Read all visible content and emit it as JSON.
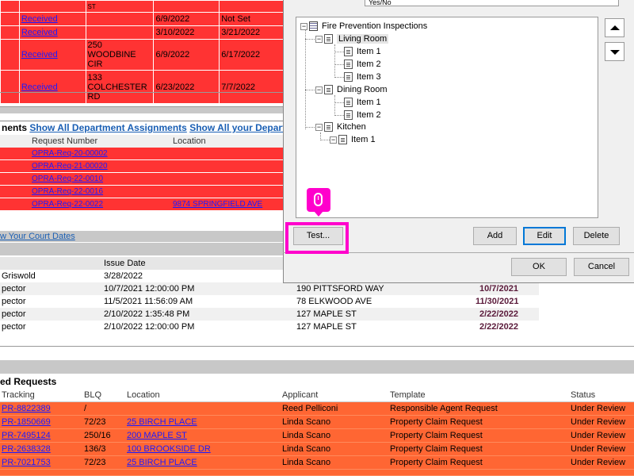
{
  "top_grid": {
    "rows": [
      {
        "status": "Received",
        "address": "ST",
        "date1": "6/9/2022",
        "date2": "Not Set"
      },
      {
        "status": "Received",
        "address": "",
        "date1": "3/10/2022",
        "date2": "3/21/2022"
      },
      {
        "status": "Received",
        "address": "250 WOODBINE CIR",
        "date1": "6/9/2022",
        "date2": "6/17/2022"
      },
      {
        "status": "Received",
        "address": "133 COLCHESTER RD",
        "date1": "6/23/2022",
        "date2": "7/7/2022"
      }
    ]
  },
  "dept_bar": {
    "prefix": "nents",
    "link1": "Show All Department Assignments",
    "link2": "Show All your Departm"
  },
  "opra": {
    "col_request": "Request Number",
    "col_location": "Location",
    "rows": [
      {
        "number": "OPRA-Req-20-00002",
        "location": ""
      },
      {
        "number": "OPRA-Req-21-00020",
        "location": ""
      },
      {
        "number": "OPRA-Req-22-0010",
        "location": ""
      },
      {
        "number": "OPRA-Req-22-0016",
        "location": ""
      },
      {
        "number": "OPRA-Req-22-0022",
        "location": "9874 SPRINGFIELD AVE"
      }
    ]
  },
  "court_link": "w Your Court Dates",
  "inspections": {
    "col_issue": "Issue Date",
    "rows": [
      {
        "name": "Griswold",
        "issue": "3/28/2022",
        "address": "",
        "due": ""
      },
      {
        "name": "pector",
        "issue": "10/7/2021 12:00:00 PM",
        "address": "190 PITTSFORD WAY",
        "due": "10/7/2021"
      },
      {
        "name": "pector",
        "issue": "11/5/2021 11:56:09 AM",
        "address": "78 ELKWOOD AVE",
        "due": "11/30/2021"
      },
      {
        "name": "pector",
        "issue": "2/10/2022 1:35:48 PM",
        "address": "127 MAPLE ST",
        "due": "2/22/2022"
      },
      {
        "name": "pector",
        "issue": "2/10/2022 12:00:00 PM",
        "address": "127 MAPLE ST",
        "due": "2/22/2022"
      }
    ]
  },
  "property_requests": {
    "title": "ed Requests",
    "headers": {
      "tracking": "Tracking",
      "blq": "BLQ",
      "location": "Location",
      "applicant": "Applicant",
      "template": "Template",
      "status": "Status"
    },
    "rows": [
      {
        "tracking": "PR-8822389",
        "blq": "/",
        "location": "",
        "applicant": "Reed Pelliconi",
        "template": "Responsible Agent Request",
        "status": "Under Review"
      },
      {
        "tracking": "PR-1850669",
        "blq": "72/23",
        "location": "25 BIRCH PLACE",
        "applicant": "Linda Scano",
        "template": "Property Claim Request",
        "status": "Under Review"
      },
      {
        "tracking": "PR-7495124",
        "blq": "250/16",
        "location": "200 MAPLE ST",
        "applicant": "Linda Scano",
        "template": "Property Claim Request",
        "status": "Under Review"
      },
      {
        "tracking": "PR-2638328",
        "blq": "136/3",
        "location": "100 BROOKSIDE DR",
        "applicant": "Linda Scano",
        "template": "Property Claim Request",
        "status": "Under Review"
      },
      {
        "tracking": "PR-7021753",
        "blq": "72/23",
        "location": "25 BIRCH PLACE",
        "applicant": "Linda Scano",
        "template": "Property Claim Request",
        "status": "Under Review"
      }
    ]
  },
  "dialog": {
    "answer_text": "Yes/No",
    "tree": {
      "root": "Fire Prevention Inspections",
      "rooms": [
        {
          "name": "Living Room",
          "items": [
            "Item 1",
            "Item 2",
            "Item 3"
          ]
        },
        {
          "name": "Dining Room",
          "items": [
            "Item 1",
            "Item 2"
          ]
        },
        {
          "name": "Kitchen",
          "items": [
            "Item 1"
          ]
        }
      ]
    },
    "buttons": {
      "test": "Test...",
      "add": "Add",
      "edit": "Edit",
      "delete": "Delete",
      "ok": "OK",
      "cancel": "Cancel"
    }
  },
  "colors": {
    "red_row": "#ff3333",
    "orange_row": "#ff6633",
    "highlight": "#ff00cc"
  }
}
